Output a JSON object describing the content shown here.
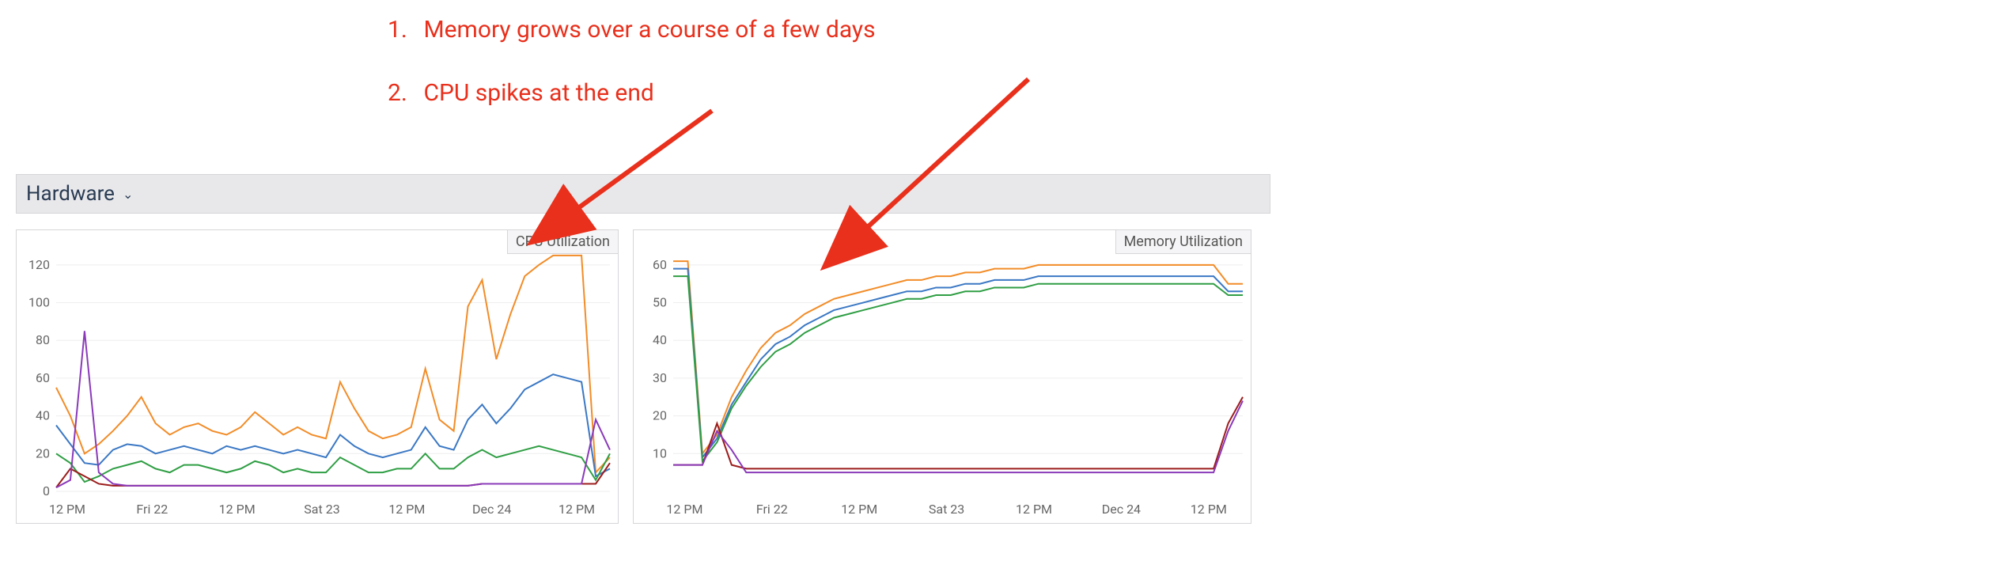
{
  "annotations": {
    "line1_num": "1.",
    "line1_text": "Memory grows over a course of a few days",
    "line2_num": "2.",
    "line2_text": "CPU spikes at the end"
  },
  "header": {
    "title": "Hardware",
    "chevron": "⌄"
  },
  "cpu": {
    "badge": "CPU Utilization",
    "x_ticks": [
      "12 PM",
      "Fri 22",
      "12 PM",
      "Sat 23",
      "12 PM",
      "Dec 24",
      "12 PM"
    ],
    "y_ticks": [
      "0",
      "20",
      "40",
      "60",
      "80",
      "100",
      "120"
    ]
  },
  "mem": {
    "badge": "Memory Utilization",
    "x_ticks": [
      "12 PM",
      "Fri 22",
      "12 PM",
      "Sat 23",
      "12 PM",
      "Dec 24",
      "12 PM"
    ],
    "y_ticks": [
      "10",
      "20",
      "30",
      "40",
      "50",
      "60"
    ]
  },
  "chart_data": [
    {
      "type": "line",
      "title": "CPU Utilization",
      "xlabel": "",
      "ylabel": "",
      "ylim": [
        0,
        130
      ],
      "x": [
        0,
        1,
        2,
        3,
        4,
        5,
        6,
        7,
        8,
        9,
        10,
        11,
        12,
        13,
        14,
        15,
        16,
        17,
        18,
        19,
        20,
        21,
        22,
        23,
        24,
        25,
        26,
        27,
        28,
        29,
        30,
        31,
        32,
        33,
        34,
        35,
        36,
        37,
        38,
        39
      ],
      "x_tick_labels": [
        "12 PM",
        "Fri 22",
        "12 PM",
        "Sat 23",
        "12 PM",
        "Dec 24",
        "12 PM"
      ],
      "series": [
        {
          "name": "orange",
          "color": "#f28c28",
          "values": [
            55,
            40,
            20,
            25,
            32,
            40,
            50,
            36,
            30,
            34,
            36,
            32,
            30,
            34,
            42,
            36,
            30,
            34,
            30,
            28,
            58,
            44,
            32,
            28,
            30,
            34,
            65,
            38,
            32,
            98,
            112,
            70,
            94,
            114,
            120,
            125,
            125,
            125,
            10,
            18
          ]
        },
        {
          "name": "blue",
          "color": "#3b78c4",
          "values": [
            35,
            25,
            15,
            14,
            22,
            25,
            24,
            20,
            22,
            24,
            22,
            20,
            24,
            22,
            24,
            22,
            20,
            22,
            20,
            18,
            30,
            24,
            20,
            18,
            20,
            22,
            34,
            24,
            22,
            38,
            46,
            36,
            44,
            54,
            58,
            62,
            60,
            58,
            8,
            12
          ]
        },
        {
          "name": "green",
          "color": "#2f9e44",
          "values": [
            20,
            15,
            5,
            8,
            12,
            14,
            16,
            12,
            10,
            14,
            14,
            12,
            10,
            12,
            16,
            14,
            10,
            12,
            10,
            10,
            18,
            14,
            10,
            10,
            12,
            12,
            20,
            12,
            12,
            18,
            22,
            18,
            20,
            22,
            24,
            22,
            20,
            18,
            6,
            20
          ]
        },
        {
          "name": "maroon",
          "color": "#9c1c1c",
          "values": [
            2,
            12,
            8,
            4,
            3,
            3,
            3,
            3,
            3,
            3,
            3,
            3,
            3,
            3,
            3,
            3,
            3,
            3,
            3,
            3,
            3,
            3,
            3,
            3,
            3,
            3,
            3,
            3,
            3,
            3,
            4,
            4,
            4,
            4,
            4,
            4,
            4,
            4,
            4,
            15
          ]
        },
        {
          "name": "purple",
          "color": "#8a3ab9",
          "values": [
            2,
            6,
            85,
            10,
            4,
            3,
            3,
            3,
            3,
            3,
            3,
            3,
            3,
            3,
            3,
            3,
            3,
            3,
            3,
            3,
            3,
            3,
            3,
            3,
            3,
            3,
            3,
            3,
            3,
            3,
            4,
            4,
            4,
            4,
            4,
            4,
            4,
            4,
            38,
            22
          ]
        }
      ]
    },
    {
      "type": "line",
      "title": "Memory Utilization",
      "xlabel": "",
      "ylabel": "",
      "ylim": [
        0,
        65
      ],
      "x": [
        0,
        1,
        2,
        3,
        4,
        5,
        6,
        7,
        8,
        9,
        10,
        11,
        12,
        13,
        14,
        15,
        16,
        17,
        18,
        19,
        20,
        21,
        22,
        23,
        24,
        25,
        26,
        27,
        28,
        29,
        30,
        31,
        32,
        33,
        34,
        35,
        36,
        37,
        38,
        39
      ],
      "x_tick_labels": [
        "12 PM",
        "Fri 22",
        "12 PM",
        "Sat 23",
        "12 PM",
        "Dec 24",
        "12 PM"
      ],
      "series": [
        {
          "name": "orange",
          "color": "#f28c28",
          "values": [
            61,
            61,
            10,
            15,
            25,
            32,
            38,
            42,
            44,
            47,
            49,
            51,
            52,
            53,
            54,
            55,
            56,
            56,
            57,
            57,
            58,
            58,
            59,
            59,
            59,
            60,
            60,
            60,
            60,
            60,
            60,
            60,
            60,
            60,
            60,
            60,
            60,
            60,
            55,
            55
          ]
        },
        {
          "name": "blue",
          "color": "#3b78c4",
          "values": [
            59,
            59,
            9,
            14,
            23,
            29,
            35,
            39,
            41,
            44,
            46,
            48,
            49,
            50,
            51,
            52,
            53,
            53,
            54,
            54,
            55,
            55,
            56,
            56,
            56,
            57,
            57,
            57,
            57,
            57,
            57,
            57,
            57,
            57,
            57,
            57,
            57,
            57,
            53,
            53
          ]
        },
        {
          "name": "green",
          "color": "#2f9e44",
          "values": [
            57,
            57,
            8,
            13,
            22,
            28,
            33,
            37,
            39,
            42,
            44,
            46,
            47,
            48,
            49,
            50,
            51,
            51,
            52,
            52,
            53,
            53,
            54,
            54,
            54,
            55,
            55,
            55,
            55,
            55,
            55,
            55,
            55,
            55,
            55,
            55,
            55,
            55,
            52,
            52
          ]
        },
        {
          "name": "maroon",
          "color": "#9c1c1c",
          "values": [
            7,
            7,
            7,
            18,
            7,
            6,
            6,
            6,
            6,
            6,
            6,
            6,
            6,
            6,
            6,
            6,
            6,
            6,
            6,
            6,
            6,
            6,
            6,
            6,
            6,
            6,
            6,
            6,
            6,
            6,
            6,
            6,
            6,
            6,
            6,
            6,
            6,
            6,
            18,
            25
          ]
        },
        {
          "name": "purple",
          "color": "#8a3ab9",
          "values": [
            7,
            7,
            7,
            16,
            11,
            5,
            5,
            5,
            5,
            5,
            5,
            5,
            5,
            5,
            5,
            5,
            5,
            5,
            5,
            5,
            5,
            5,
            5,
            5,
            5,
            5,
            5,
            5,
            5,
            5,
            5,
            5,
            5,
            5,
            5,
            5,
            5,
            5,
            16,
            24
          ]
        }
      ]
    }
  ]
}
